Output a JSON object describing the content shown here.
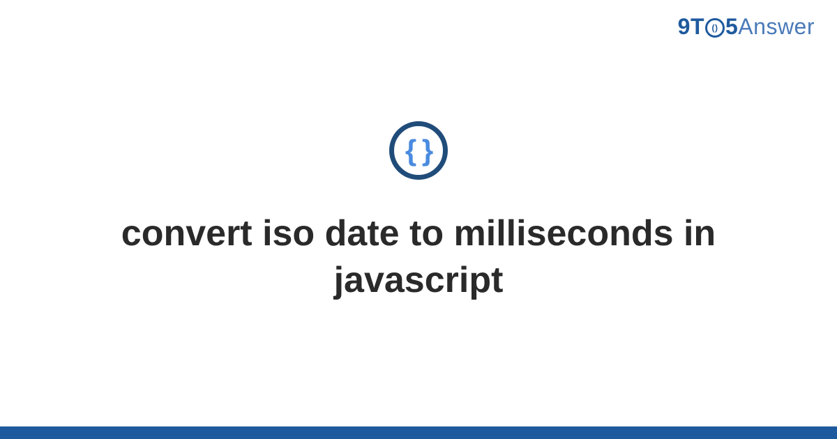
{
  "brand": {
    "prefix": "9T",
    "clock_inner": "()",
    "mid": "5",
    "suffix": "Answer"
  },
  "icon": {
    "braces": "{ }"
  },
  "title": "convert iso date to milliseconds in javascript"
}
